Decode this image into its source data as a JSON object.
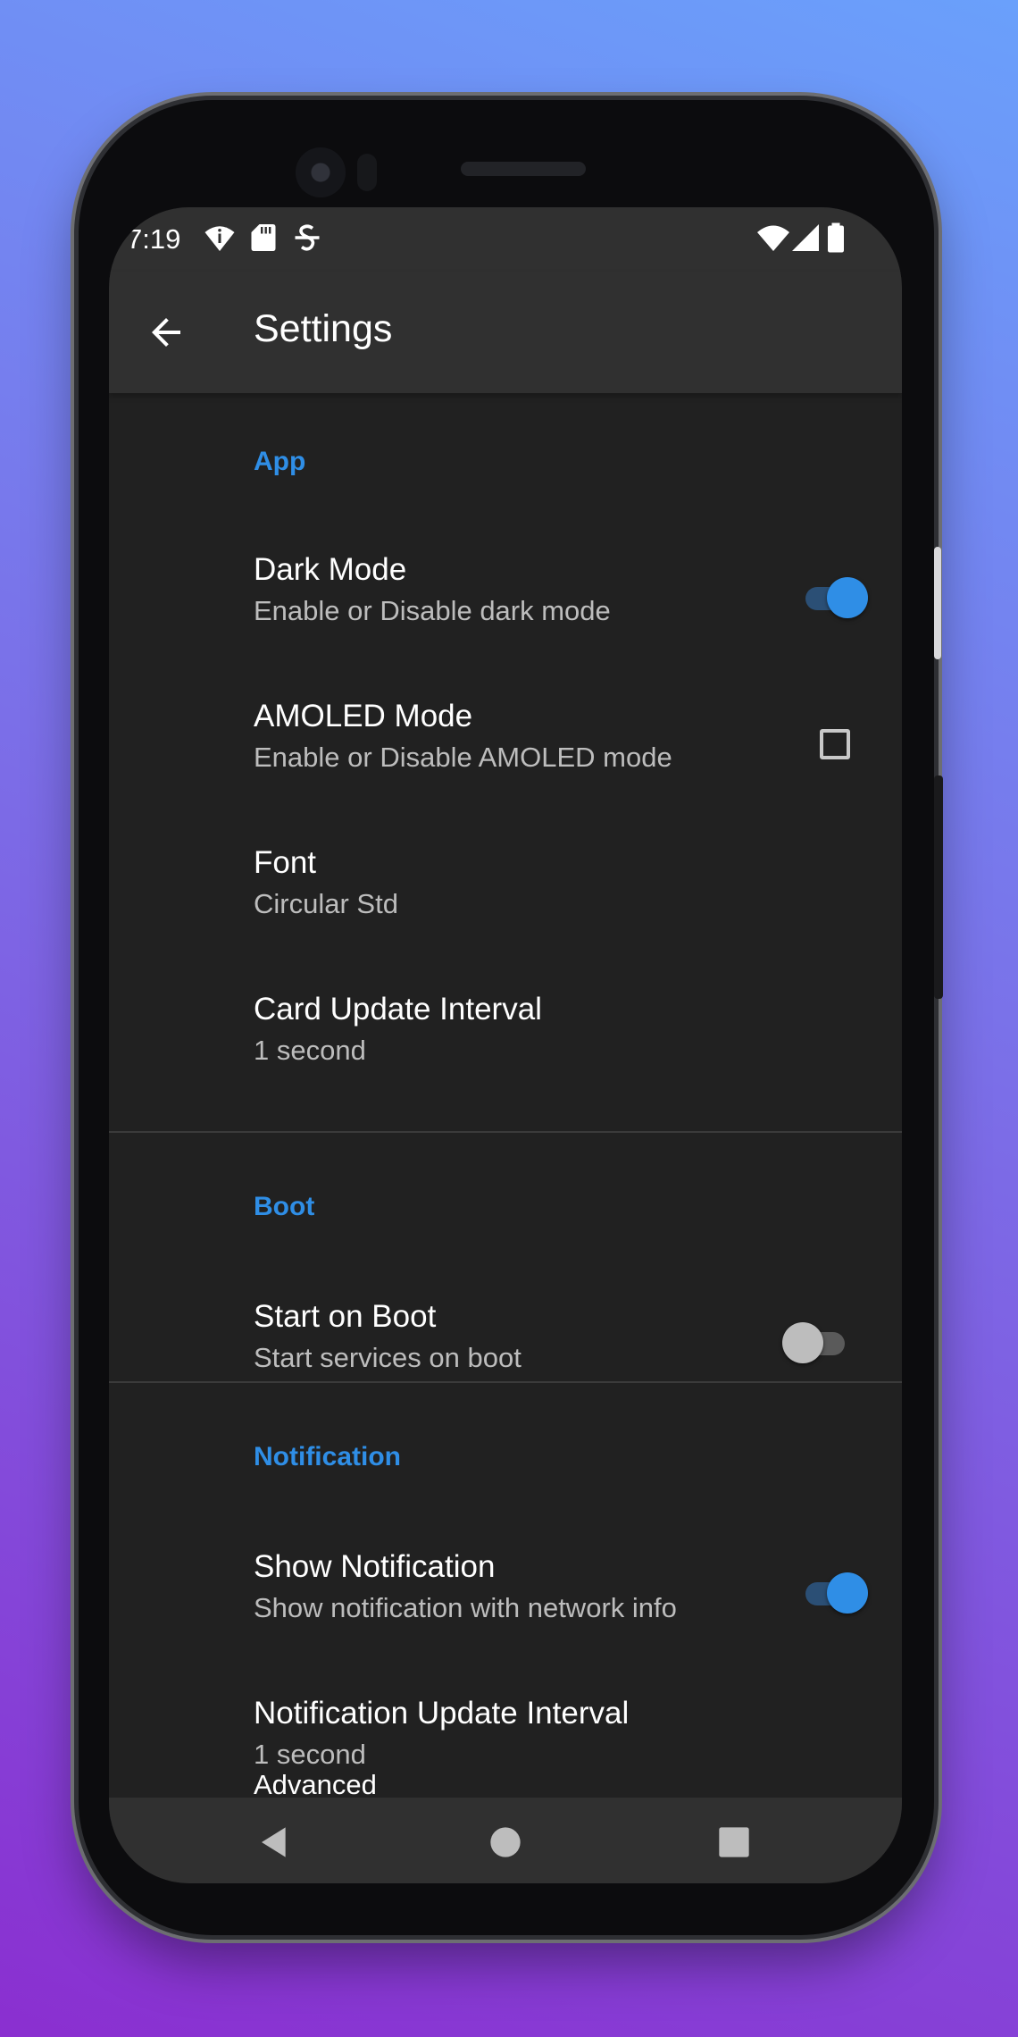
{
  "status_bar": {
    "time": "7:19",
    "left_icons": [
      "wifi-hotspot-icon",
      "sd-card-icon",
      "speed-meter-icon"
    ],
    "right_icons": [
      "wifi-icon",
      "cellular-signal-icon",
      "battery-icon"
    ]
  },
  "app_bar": {
    "title": "Settings",
    "back_icon": "arrow-back-icon"
  },
  "sections": {
    "app": {
      "header": "App",
      "dark_mode": {
        "title": "Dark Mode",
        "summary": "Enable or Disable dark mode",
        "control": "switch",
        "checked": true
      },
      "amoled_mode": {
        "title": "AMOLED Mode",
        "summary": "Enable or Disable AMOLED mode",
        "control": "checkbox",
        "checked": false
      },
      "font": {
        "title": "Font",
        "summary": "Circular Std"
      },
      "card_update_interval": {
        "title": "Card Update Interval",
        "summary": "1 second"
      }
    },
    "boot": {
      "header": "Boot",
      "start_on_boot": {
        "title": "Start on Boot",
        "summary": "Start services on boot",
        "control": "switch",
        "checked": false
      }
    },
    "notification": {
      "header": "Notification",
      "show_notification": {
        "title": "Show Notification",
        "summary": "Show notification with network info",
        "control": "switch",
        "checked": true
      },
      "notification_update_interval": {
        "title": "Notification Update Interval",
        "summary": "1 second"
      }
    },
    "advanced": {
      "header": "Advanced"
    }
  },
  "nav_bar": {
    "icons": [
      "nav-back-icon",
      "nav-home-icon",
      "nav-recents-icon"
    ]
  },
  "colors": {
    "accent": "#2f8ee6",
    "background": "#212121",
    "app_bar": "#303030",
    "switch_track_on": "#2b4f75",
    "switch_thumb_off": "#bdbdbd"
  }
}
